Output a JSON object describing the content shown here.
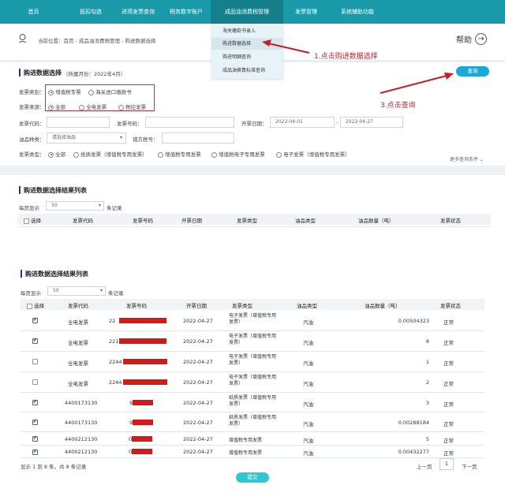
{
  "nav": [
    "首页",
    "抵扣勾选",
    "进项发票查询",
    "税务数字账户",
    "成品油消费税管理",
    "发票管理",
    "系统辅助功能"
  ],
  "breadcrumb": "当前位置：首页 - 成品油消费税管理 - 购进数据选择",
  "help_label": "帮助",
  "dropdown": [
    "海关缴款书录入",
    "购进数据选择",
    "购进明细查询",
    "成品油换算标准查询"
  ],
  "annotations": {
    "a1": "1.点击购进数据选择",
    "a3": "3.点击查询"
  },
  "filter": {
    "title": "购进数据选择",
    "period": "（所属月份：2022年4月）",
    "query_button": "查询",
    "invoice_category_label": "发票类别：",
    "invoice_category_options": [
      "增值税专票",
      "海关进口缴款书"
    ],
    "invoice_source_label": "发票来源：",
    "invoice_source_options": [
      "全部",
      "全电发票",
      "税控发票"
    ],
    "invoice_code_label": "发票代码：",
    "invoice_number_label": "发票号码：",
    "issue_date_label": "开票日期：",
    "date_from": "2022-04-01",
    "date_sep": "-",
    "date_to": "2022-04-27",
    "oil_type_label": "油品种类：",
    "oil_type_placeholder": "请选择油品",
    "seller_tax_label": "销方税号：",
    "invoice_type_label": "发票类型：",
    "invoice_type_options": [
      "全部",
      "纸质发票（增值税专用发票）",
      "增值税专用发票",
      "增值税电子专用发票",
      "电子发票（增值税专用发票）"
    ],
    "more_conditions": "更多查询条件"
  },
  "result_top": {
    "title": "购进数据选择结果列表",
    "page_size_prefix": "每页显示",
    "page_size": "50",
    "page_size_suffix": "条记录",
    "headers": [
      "选择",
      "发票代码",
      "发票号码",
      "开票日期",
      "发票类型",
      "油品类型",
      "油品数量（吨）",
      "发票状态"
    ]
  },
  "result": {
    "title": "购进数据选择结果列表",
    "page_size_prefix": "每页显示",
    "page_size": "50",
    "page_size_suffix": "条记录",
    "headers": [
      "选择",
      "发票代码",
      "发票号码",
      "开票日期",
      "发票类型",
      "油品类型",
      "油品数量（吨）",
      "发票状态"
    ],
    "rows": [
      {
        "checked": true,
        "code": "全电发票",
        "number": "22",
        "date": "2022-04-27",
        "type": "电子发票（增值税专用发票）",
        "oil": "汽油",
        "qty": "0.00504323",
        "status": "正常"
      },
      {
        "checked": true,
        "code": "全电发票",
        "number": "221",
        "date": "2022-04-27",
        "type": "电子发票（增值税专用发票）",
        "oil": "汽油",
        "qty": "8",
        "status": "正常"
      },
      {
        "checked": false,
        "code": "全电发票",
        "number": "2244",
        "date": "2022-04-27",
        "type": "电子发票（增值税专用发票）",
        "oil": "汽油",
        "qty": "1",
        "status": "正常"
      },
      {
        "checked": false,
        "code": "全电发票",
        "number": "2244",
        "date": "2022-04-27",
        "type": "电子发票（增值税专用发票）",
        "oil": "汽油",
        "qty": "2",
        "status": "正常"
      },
      {
        "checked": true,
        "code": "4400173130",
        "number": "9",
        "date": "2022-04-27",
        "type": "纸质发票（增值税专用发票）",
        "oil": "汽油",
        "qty": "3",
        "status": "正常"
      },
      {
        "checked": true,
        "code": "4400173130",
        "number": "9",
        "date": "2022-04-27",
        "type": "纸质发票（增值税专用发票）",
        "oil": "汽油",
        "qty": "0.00288184",
        "status": "正常"
      },
      {
        "checked": true,
        "code": "4400212130",
        "number": "0",
        "date": "2022-04-27",
        "type": "增值税专用发票",
        "oil": "汽油",
        "qty": "5",
        "status": "正常"
      },
      {
        "checked": true,
        "code": "4400212130",
        "number": "0",
        "date": "2022-04-27",
        "type": "增值税专用发票",
        "oil": "汽油",
        "qty": "0.00432277",
        "status": "正常"
      }
    ],
    "summary": "显示 1 到 8 条，共 8 条记录",
    "prev": "上一页",
    "page": "1",
    "next": "下一页",
    "submit": "提交"
  },
  "colors": {
    "nav": "#1a9aa8",
    "accent": "#1aa8d6",
    "annotation": "#c21f2b",
    "redaction": "#d21a1a"
  }
}
